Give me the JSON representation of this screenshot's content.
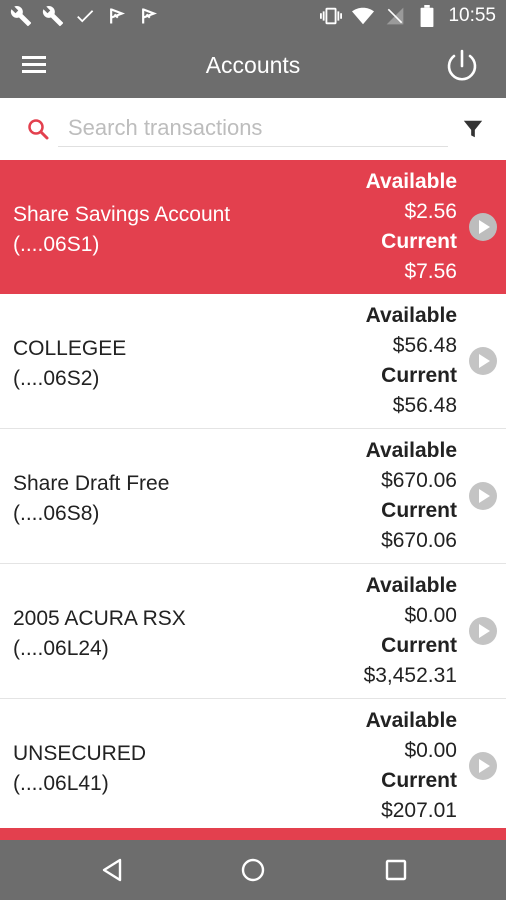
{
  "status_bar": {
    "time": "10:55",
    "left_icons": [
      "wrench-icon",
      "wrench-icon",
      "check-icon",
      "flag-icon",
      "flag-icon"
    ],
    "right_icons": [
      "vibrate-icon",
      "wifi-icon",
      "no-signal-icon",
      "battery-icon"
    ]
  },
  "app_bar": {
    "title": "Accounts",
    "menu_icon": "hamburger-menu-icon",
    "power_icon": "power-icon"
  },
  "search": {
    "placeholder": "Search transactions",
    "value": "",
    "filter_icon": "filter-icon"
  },
  "accounts": [
    {
      "name": "Share Savings Account",
      "number": "(....06S1)",
      "available_label": "Available",
      "available": "$2.56",
      "current_label": "Current",
      "current": "$7.56",
      "selected": true
    },
    {
      "name": "COLLEGEE",
      "number": "(....06S2)",
      "available_label": "Available",
      "available": "$56.48",
      "current_label": "Current",
      "current": "$56.48",
      "selected": false
    },
    {
      "name": "Share Draft Free",
      "number": "(....06S8)",
      "available_label": "Available",
      "available": "$670.06",
      "current_label": "Current",
      "current": "$670.06",
      "selected": false
    },
    {
      "name": "2005 ACURA RSX",
      "number": "(....06L24)",
      "available_label": "Available",
      "available": "$0.00",
      "current_label": "Current",
      "current": "$3,452.31",
      "selected": false
    },
    {
      "name": "UNSECURED",
      "number": "(....06L41)",
      "available_label": "Available",
      "available": "$0.00",
      "current_label": "Current",
      "current": "$207.01",
      "selected": false
    }
  ],
  "nav_bar": {
    "buttons": [
      "back-icon",
      "home-icon",
      "recents-icon"
    ]
  },
  "colors": {
    "bar_gray": "#6d6d6d",
    "accent_red": "#e3404e",
    "chevron_gray": "#bdbdbd"
  }
}
